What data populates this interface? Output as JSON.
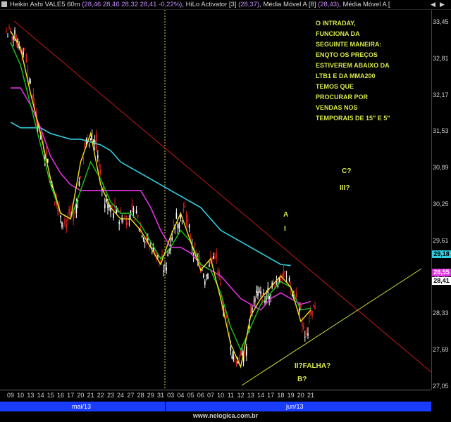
{
  "header": {
    "instrument": "Heikin Ashi VALE5 60m",
    "instrument_values": "(28,46 28,46 28,32 28,41 -0,22%)",
    "hilo": "HiLo Activator [3]",
    "hilo_value": "(28,37)",
    "mm1": "Média Móvel A [8]",
    "mm1_value": "(28,43)",
    "mm2": "Média Móvel A [",
    "sep": ","
  },
  "annotation_text": [
    "O INTRADAY,",
    "FUNCIONA DA",
    "SEGUINTE MANEIRA:",
    "ENQTO OS PREÇOS",
    "ESTIVEREM ABAIXO DA",
    "LTB1 E DA MMA200",
    "TEMOS QUE",
    "PROCURAR POR",
    "VENDAS NOS",
    "TEMPORAIS DE 15\" E 5\""
  ],
  "wave_labels": {
    "a": "A",
    "i": "I",
    "c": "C?",
    "iii": "III?",
    "ii": "II?FALHA?",
    "b": "B?"
  },
  "price_tags": {
    "ma_cyan": "29,18",
    "ma_magenta": "28,55",
    "last": "28,41"
  },
  "colors": {
    "up": "#ffffff",
    "down": "#d42020",
    "hilo": "#f0e020",
    "ma_green": "#18c818",
    "ma_magenta": "#e030e0",
    "ma_cyan": "#30d0e0",
    "trendline_down": "#c01818",
    "trendline_up": "#d8e040",
    "vline": "#d8d060"
  },
  "footer": {
    "month1": "mai/13",
    "month2": "jun/13",
    "site": "www.nelogica.com.br"
  },
  "chart_data": {
    "type": "candlestick",
    "y_ticks": [
      "33,45",
      "32,81",
      "32,17",
      "31,53",
      "30,89",
      "30,25",
      "29,61",
      "28,97",
      "28,33",
      "27,69",
      "27,05"
    ],
    "x_ticks": [
      "09",
      "10",
      "13",
      "14",
      "15",
      "16",
      "17",
      "20",
      "21",
      "22",
      "23",
      "24",
      "27",
      "28",
      "29",
      "31",
      "03",
      "04",
      "05",
      "06",
      "07",
      "10",
      "11",
      "12",
      "13",
      "14",
      "17",
      "18",
      "19",
      "20",
      "21"
    ],
    "ylim": [
      27.05,
      33.45
    ],
    "close_by_day": [
      33.2,
      32.9,
      31.9,
      31.2,
      30.4,
      29.9,
      30.1,
      31.3,
      31.5,
      30.3,
      30.1,
      30.0,
      30.1,
      29.7,
      29.4,
      29.1,
      30.0,
      30.1,
      29.4,
      29.0,
      29.4,
      28.3,
      27.5,
      27.6,
      28.7,
      28.6,
      28.9,
      29.0,
      28.7,
      28.0,
      28.4
    ],
    "series": [
      {
        "name": "HiLo Activator [3]",
        "values": [
          33.3,
          33.0,
          32.2,
          31.5,
          30.7,
          30.1,
          30.0,
          31.0,
          31.5,
          30.6,
          30.2,
          30.0,
          30.0,
          29.8,
          29.5,
          29.2,
          29.7,
          30.1,
          29.6,
          29.1,
          29.3,
          28.6,
          27.8,
          27.4,
          28.3,
          28.6,
          28.8,
          29.0,
          28.8,
          28.2,
          28.4
        ]
      },
      {
        "name": "Média Móvel A [8]",
        "values": [
          33.1,
          32.7,
          32.0,
          31.3,
          30.6,
          30.1,
          30.0,
          30.5,
          31.0,
          30.7,
          30.3,
          30.1,
          30.1,
          29.9,
          29.6,
          29.3,
          29.5,
          29.8,
          29.6,
          29.2,
          29.1,
          28.7,
          28.1,
          27.7,
          28.1,
          28.5,
          28.7,
          28.9,
          28.8,
          28.4,
          28.43
        ]
      },
      {
        "name": "Média Móvel A [",
        "values": [
          32.3,
          32.3,
          32.0,
          31.6,
          31.1,
          30.8,
          30.6,
          30.5,
          30.5,
          30.5,
          30.5,
          30.5,
          30.5,
          30.5,
          30.2,
          29.8,
          29.5,
          29.5,
          29.4,
          29.2,
          29.1,
          29.0,
          28.8,
          28.6,
          28.5,
          28.4,
          28.6,
          28.7,
          28.6,
          28.5,
          28.55
        ]
      },
      {
        "name": "",
        "values": [
          31.7,
          31.6,
          31.6,
          31.6,
          31.5,
          31.45,
          31.4,
          31.4,
          31.35,
          31.3,
          31.2,
          31.0,
          30.9,
          30.8,
          30.7,
          30.6,
          30.5,
          30.4,
          30.3,
          30.2,
          30.0,
          29.8,
          29.7,
          29.6,
          29.5,
          29.4,
          29.3,
          29.2,
          29.18
        ]
      }
    ]
  }
}
